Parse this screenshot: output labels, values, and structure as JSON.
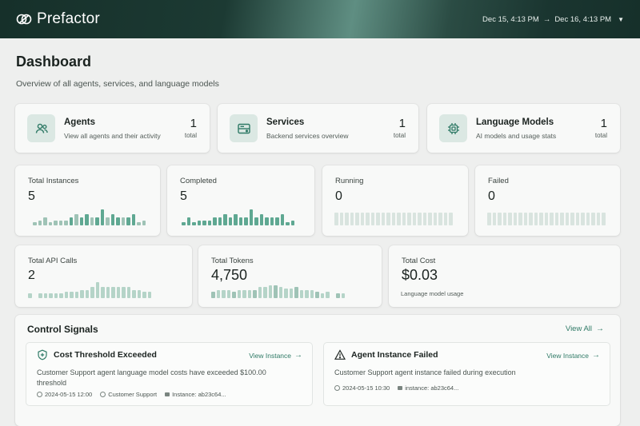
{
  "app": {
    "brand": "Prefactor"
  },
  "header": {
    "date_start": "Dec 15, 4:13 PM",
    "date_sep": "→",
    "date_end": "Dec 16, 4:13 PM"
  },
  "page": {
    "title": "Dashboard",
    "subtitle": "Overview of all agents, services, and language models"
  },
  "features": [
    {
      "title": "Agents",
      "desc": "View all agents and their activity",
      "count": "1",
      "count_label": "total",
      "icon": "users-icon"
    },
    {
      "title": "Services",
      "desc": "Backend services overview",
      "count": "1",
      "count_label": "total",
      "icon": "server-icon"
    },
    {
      "title": "Language Models",
      "desc": "AI models and usage stats",
      "count": "1",
      "count_label": "total",
      "icon": "chip-icon"
    }
  ],
  "stats_row1": [
    {
      "label": "Total Instances",
      "value": "5"
    },
    {
      "label": "Completed",
      "value": "5"
    },
    {
      "label": "Running",
      "value": "0"
    },
    {
      "label": "Failed",
      "value": "0"
    }
  ],
  "stats_row2": [
    {
      "label": "Total API Calls",
      "value": "2"
    },
    {
      "label": "Total Tokens",
      "value": "4,750"
    },
    {
      "label": "Total Cost",
      "value": "$0.03",
      "foot": "Language model usage"
    }
  ],
  "signals": {
    "title": "Control Signals",
    "view_all": "View All",
    "items": [
      {
        "title": "Cost Threshold Exceeded",
        "link": "View Instance",
        "desc_line1": "Customer Support agent language model costs have exceeded $100.00",
        "desc_line2": "threshold",
        "date": "2024-05-15 12:00",
        "agent": "Customer Support",
        "instance": "Instance: ab23c64..."
      },
      {
        "title": "Agent Instance Failed",
        "link": "View Instance",
        "desc_line1": "Customer Support agent instance failed during execution",
        "date": "2024-05-15 10:30",
        "instance": "instance: ab23c64..."
      }
    ]
  },
  "colors": {
    "accent": "#2f7a66",
    "spark_dark": "#5fa892",
    "spark_light": "#b5d4c8",
    "spark_empty": "#d9e4df"
  }
}
